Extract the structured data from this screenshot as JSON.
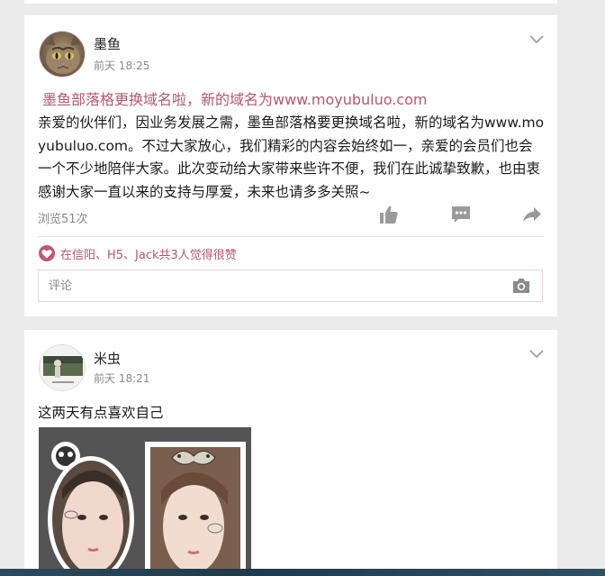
{
  "posts": [
    {
      "author": "墨鱼",
      "time": "前天 18:25",
      "title": "墨鱼部落格更换域名啦，新的域名为www.moyubuluo.com",
      "body": "亲爱的伙伴们，因业务发展之需，墨鱼部落格要更换域名啦，新的域名为www.moyubuluo.com。不过大家放心，我们精彩的内容会始终如一，亲爱的会员们也会一个不少地陪伴大家。此次变动给大家带来些许不便，我们在此诚挚致歉，也由衷感谢大家一直以来的支持与厚爱，未来也请多多关照~",
      "views": "浏览51次",
      "likes_text": "在信阳、H5、Jack共3人觉得很赞",
      "comment_placeholder": "评论"
    },
    {
      "author": "米虫",
      "time": "前天 18:21",
      "text": "这两天有点喜欢自己"
    }
  ],
  "colors": {
    "accent": "#b5576e",
    "background": "#ebebeb",
    "card": "#ffffff",
    "icon_gray": "#9a9a9a"
  },
  "icons": {
    "more": "chevron-down-icon",
    "like": "thumbs-up-icon",
    "comment": "comment-icon",
    "share": "share-icon",
    "likes_badge": "heart-icon",
    "camera": "camera-icon"
  }
}
